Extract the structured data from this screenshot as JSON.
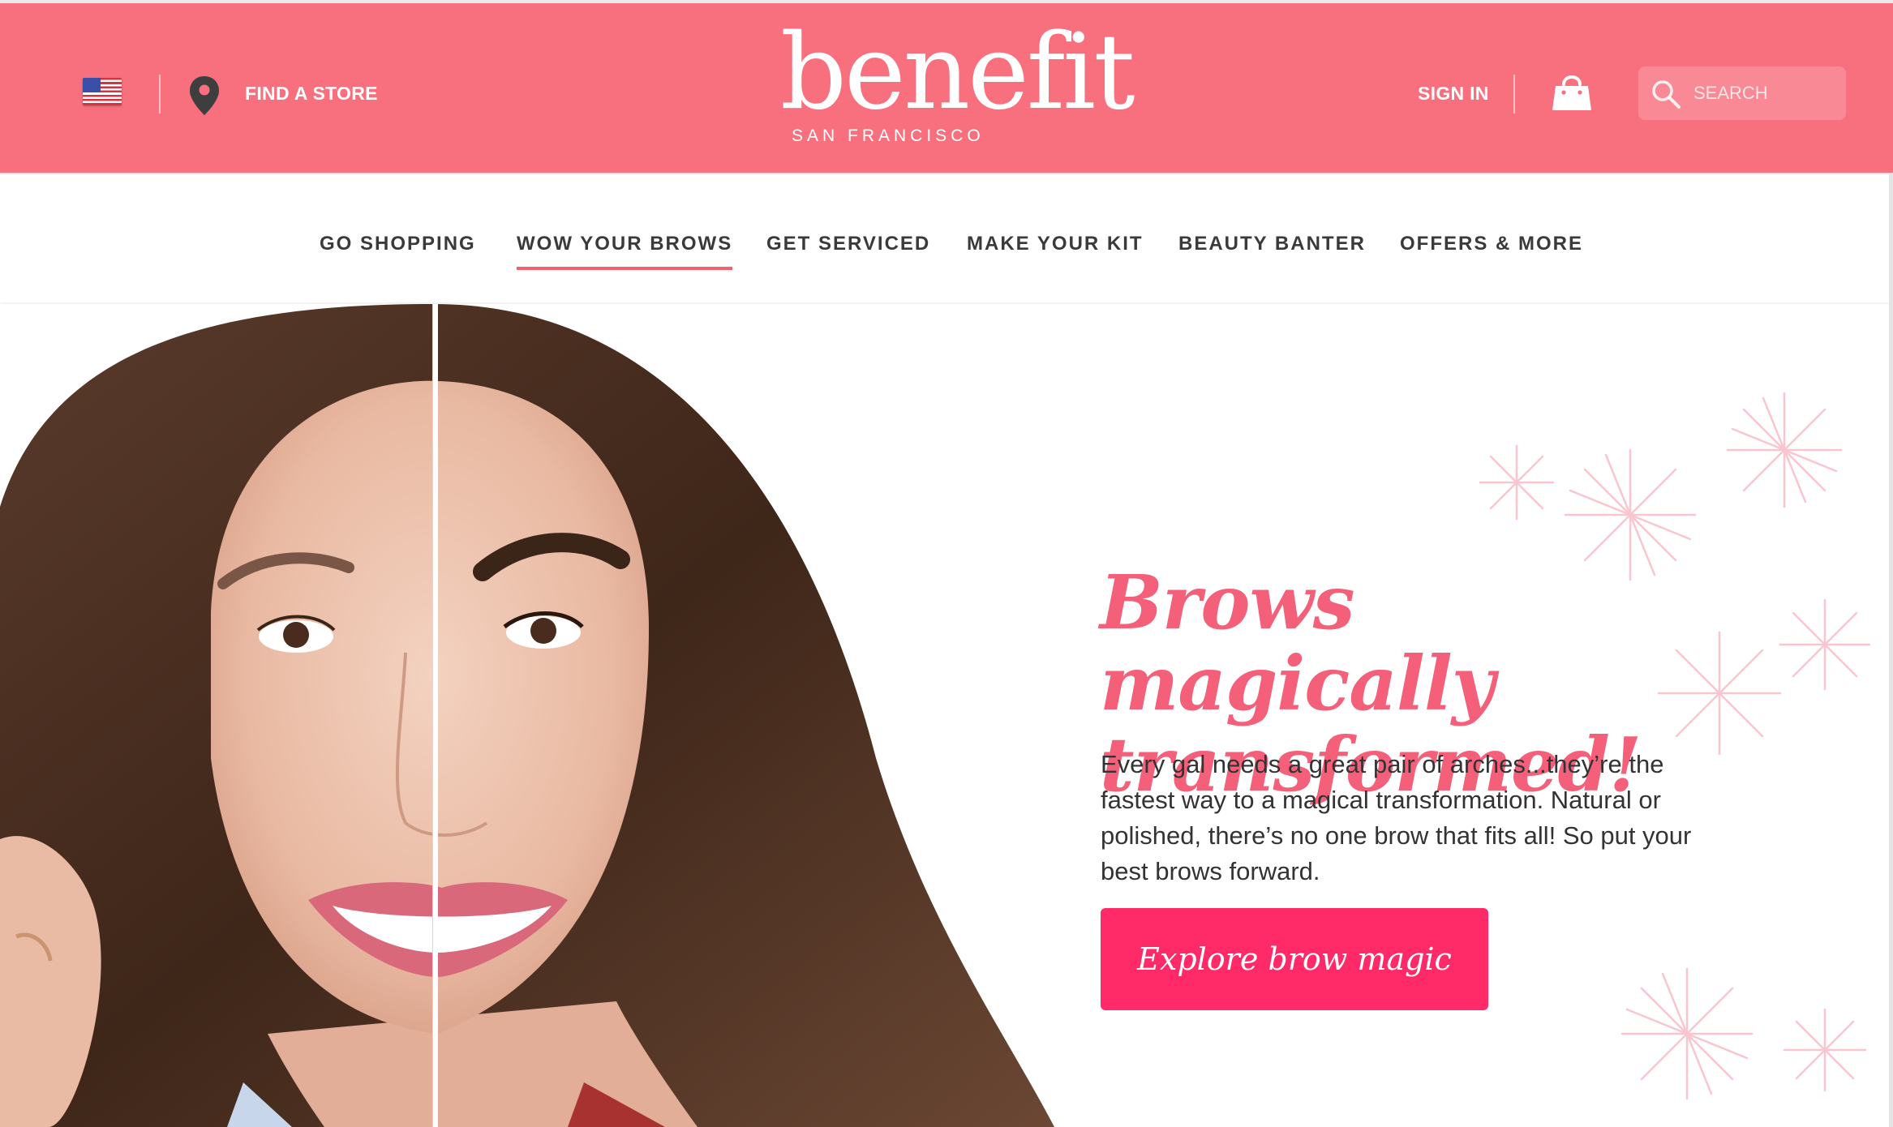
{
  "header": {
    "country_flag": "us-flag-icon",
    "find_store_label": "FIND A STORE",
    "logo_word": "benefit",
    "logo_sub": "SAN FRANCISCO",
    "sign_in_label": "SIGN IN",
    "search_placeholder": "SEARCH",
    "bg_color": "#f8707d"
  },
  "nav": {
    "items": [
      {
        "label": "GO SHOPPING"
      },
      {
        "label": "WOW YOUR BROWS",
        "active": true
      },
      {
        "label": "GET SERVICED"
      },
      {
        "label": "MAKE YOUR KIT"
      },
      {
        "label": "BEAUTY BANTER"
      },
      {
        "label": "OFFERS & MORE"
      }
    ],
    "active_color": "#f4616f"
  },
  "hero": {
    "headline_line1": "Brows magically",
    "headline_line2": "transformed!",
    "body": "Every gal needs a great pair of arches...they’re the fastest way to a magical transformation. Natural or polished, there’s no one brow that fits all! So put your best brows forward.",
    "cta_label": "Explore brow magic",
    "cta_color": "#ff2a67",
    "headline_color": "#f4607a"
  }
}
